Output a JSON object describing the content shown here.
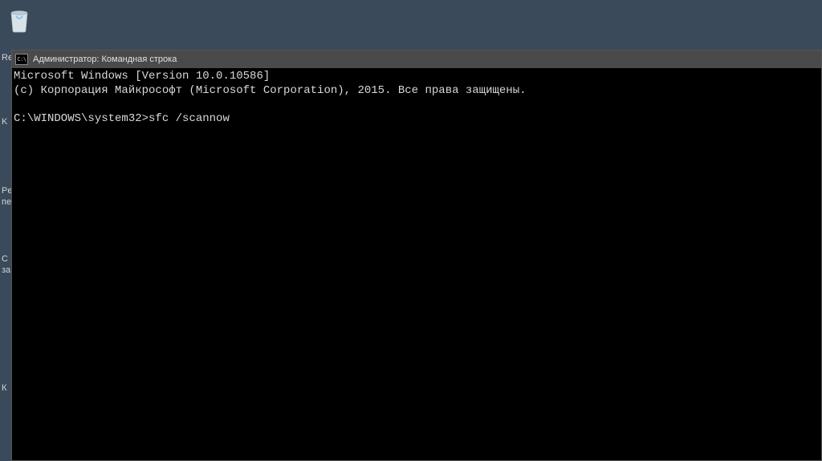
{
  "desktop": {
    "bg_fragments": {
      "f1": "Re",
      "f2": "K",
      "f3": "Pe",
      "f3b": "пе",
      "f4": "С",
      "f5": "за",
      "f6": "К"
    }
  },
  "cmd": {
    "titlebar_icon_glyph": "C:\\",
    "title": "Администратор: Командная строка",
    "line1": "Microsoft Windows [Version 10.0.10586]",
    "line2": "(c) Корпорация Майкрософт (Microsoft Corporation), 2015. Все права защищены.",
    "blank": "",
    "prompt": "C:\\WINDOWS\\system32>",
    "command": "sfc /scannow"
  }
}
